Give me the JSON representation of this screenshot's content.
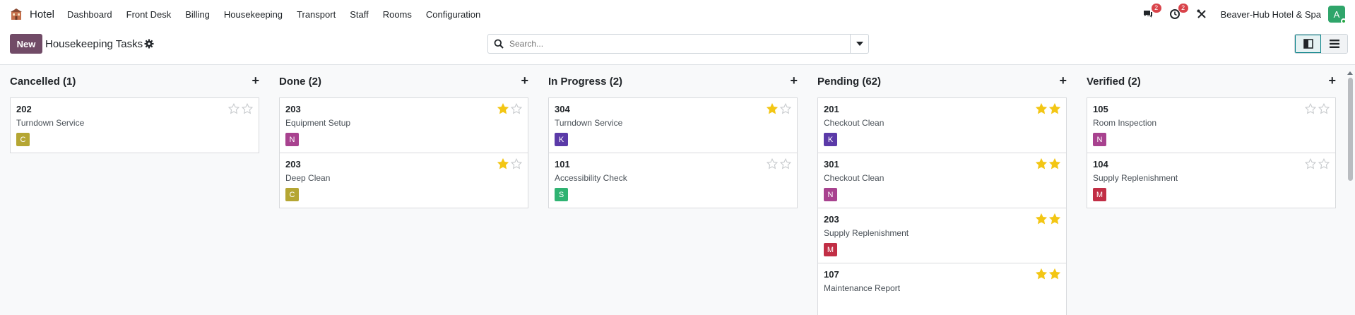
{
  "navbar": {
    "app_name": "Hotel",
    "menu": [
      "Dashboard",
      "Front Desk",
      "Billing",
      "Housekeeping",
      "Transport",
      "Staff",
      "Rooms",
      "Configuration"
    ],
    "messages_count": "2",
    "activities_count": "2",
    "company": "Beaver-Hub Hotel & Spa",
    "user_initial": "A"
  },
  "control": {
    "new_label": "New",
    "title": "Housekeeping Tasks",
    "search_placeholder": "Search..."
  },
  "columns": [
    {
      "title": "Cancelled (1)",
      "cards": [
        {
          "room": "202",
          "task": "Turndown Service",
          "initial": "C",
          "color": "#b5a633",
          "stars": 0
        }
      ]
    },
    {
      "title": "Done (2)",
      "cards": [
        {
          "room": "203",
          "task": "Equipment Setup",
          "initial": "N",
          "color": "#a8428f",
          "stars": 1
        },
        {
          "room": "203",
          "task": "Deep Clean",
          "initial": "C",
          "color": "#b5a633",
          "stars": 1
        }
      ]
    },
    {
      "title": "In Progress (2)",
      "cards": [
        {
          "room": "304",
          "task": "Turndown Service",
          "initial": "K",
          "color": "#5b3aa8",
          "stars": 1
        },
        {
          "room": "101",
          "task": "Accessibility Check",
          "initial": "S",
          "color": "#2fb372",
          "stars": 0
        }
      ]
    },
    {
      "title": "Pending (62)",
      "cards": [
        {
          "room": "201",
          "task": "Checkout Clean",
          "initial": "K",
          "color": "#5b3aa8",
          "stars": 2
        },
        {
          "room": "301",
          "task": "Checkout Clean",
          "initial": "N",
          "color": "#a8428f",
          "stars": 2
        },
        {
          "room": "203",
          "task": "Supply Replenishment",
          "initial": "M",
          "color": "#c12e45",
          "stars": 2
        },
        {
          "room": "107",
          "task": "Maintenance Report",
          "initial": "",
          "color": "",
          "stars": 2
        }
      ]
    },
    {
      "title": "Verified (2)",
      "cards": [
        {
          "room": "105",
          "task": "Room Inspection",
          "initial": "N",
          "color": "#a8428f",
          "stars": 0
        },
        {
          "room": "104",
          "task": "Supply Replenishment",
          "initial": "M",
          "color": "#c12e45",
          "stars": 0
        }
      ]
    }
  ],
  "colors": {
    "brand": "#714b67",
    "star_filled": "#f3c614",
    "star_empty": "#c7cacd",
    "badge": "#d9434a"
  },
  "icons": [
    "hotel-logo-icon",
    "chat-icon",
    "clock-icon",
    "tools-icon",
    "gear-icon",
    "search-icon",
    "caret-down-icon",
    "kanban-view-icon",
    "list-view-icon",
    "plus-icon",
    "star-icon"
  ]
}
